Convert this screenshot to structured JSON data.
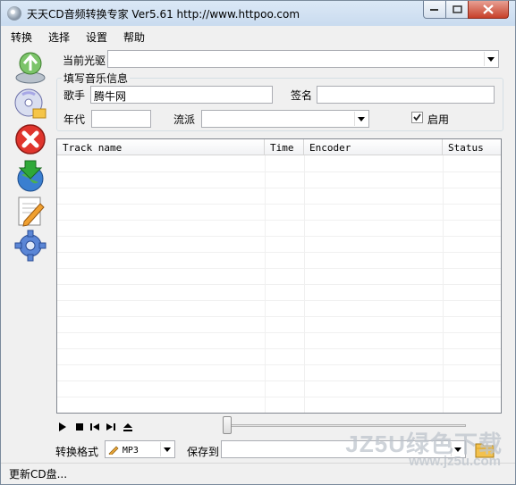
{
  "window": {
    "title": "天天CD音频转换专家 Ver5.61    http://www.httpoo.com"
  },
  "menu": [
    "转换",
    "选择",
    "设置",
    "帮助"
  ],
  "toolbar": {
    "icons": [
      "recycle-disc-icon",
      "open-disc-folder-icon",
      "stop-red-x-icon",
      "download-globe-icon",
      "edit-document-icon",
      "settings-gear-icon"
    ]
  },
  "drive": {
    "label": "当前光驱",
    "value": ""
  },
  "music_info": {
    "title": "填写音乐信息",
    "artist_label": "歌手",
    "artist_value": "腾牛网",
    "sign_label": "签名",
    "sign_value": "",
    "year_label": "年代",
    "year_value": "",
    "genre_label": "流派",
    "genre_value": "",
    "enable_label": "启用",
    "enable_checked": true
  },
  "tracks": {
    "columns": [
      "Track name",
      "Time",
      "Encoder",
      "Status"
    ],
    "rows": []
  },
  "player": {
    "controls": [
      "play-icon",
      "stop-icon",
      "previous-icon",
      "next-icon",
      "eject-icon"
    ],
    "progress": 0
  },
  "output": {
    "format_label": "转换格式",
    "format_value": "MP3",
    "save_label": "保存到",
    "save_value": ""
  },
  "status": {
    "text": "更新CD盘..."
  },
  "watermark": {
    "line1": "JZ5U绿色下载",
    "line2": "www.jz5u.com"
  }
}
